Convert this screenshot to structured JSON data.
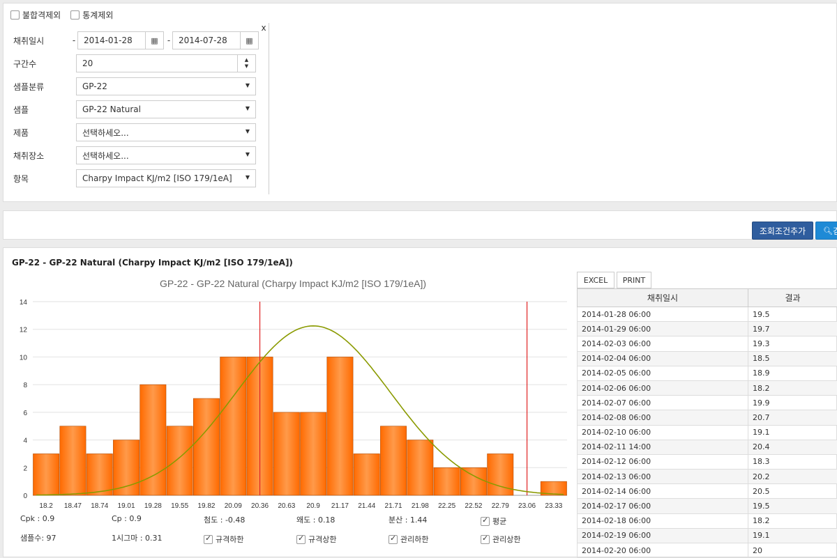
{
  "filters": {
    "exclude_nonconforming": "불합격제외",
    "exclude_stats": "통계제외",
    "close": "x",
    "date_label": "채취일시",
    "date_from": "2014-01-28",
    "date_to": "2014-07-28",
    "bins_label": "구간수",
    "bins_value": "20",
    "sample_class_label": "샘플분류",
    "sample_class_value": "GP-22",
    "sample_label": "샘플",
    "sample_value": "GP-22 Natural",
    "product_label": "제품",
    "product_value": "선택하세오...",
    "location_label": "채취장소",
    "location_value": "선택하세오...",
    "item_label": "항목",
    "item_value": "Charpy Impact KJ/m2 [ISO 179/1eA]"
  },
  "actions": {
    "add_condition": "조회조건추가",
    "search": "검"
  },
  "section_title": "GP-22 - GP-22 Natural (Charpy Impact KJ/m2 [ISO 179/1eA])",
  "chart_data": {
    "type": "bar",
    "title": "GP-22 - GP-22 Natural (Charpy Impact KJ/m2 [ISO 179/1eA])",
    "categories": [
      "18.2",
      "18.47",
      "18.74",
      "19.01",
      "19.28",
      "19.55",
      "19.82",
      "20.09",
      "20.36",
      "20.63",
      "20.9",
      "21.17",
      "21.44",
      "21.71",
      "21.98",
      "22.25",
      "22.52",
      "22.79",
      "23.06",
      "23.33"
    ],
    "values": [
      3,
      5,
      3,
      4,
      8,
      5,
      7,
      10,
      10,
      6,
      6,
      10,
      3,
      5,
      4,
      2,
      2,
      3,
      0,
      1
    ],
    "normal_curve": {
      "mean": 20.9,
      "peak": 12.25
    },
    "spec_lines": [
      20.36,
      23.06
    ],
    "ylim": [
      0,
      14
    ],
    "yticks": [
      0,
      2,
      4,
      6,
      8,
      10,
      12,
      14
    ],
    "bar_color": "#ff7a1a",
    "curve_color": "#8a9a00",
    "line_color": "#e02020"
  },
  "stats": {
    "cpk": "Cpk : 0.9",
    "cp": "Cp : 0.9",
    "kurtosis": "첨도 : -0.48",
    "skewness": "왜도 : 0.18",
    "variance": "분산 : 1.44",
    "mean_label": "평균",
    "samples": "샘플수: 97",
    "sigma": "1시그마 : 0.31",
    "lsl": "규격하한",
    "usl": "규격상한",
    "lcl": "관리하한",
    "ucl": "관리상한"
  },
  "table": {
    "excel": "EXCEL",
    "print": "PRINT",
    "col_date": "채취일시",
    "col_result": "결과",
    "rows": [
      [
        "2014-01-28 06:00",
        "19.5"
      ],
      [
        "2014-01-29 06:00",
        "19.7"
      ],
      [
        "2014-02-03 06:00",
        "19.3"
      ],
      [
        "2014-02-04 06:00",
        "18.5"
      ],
      [
        "2014-02-05 06:00",
        "18.9"
      ],
      [
        "2014-02-06 06:00",
        "18.2"
      ],
      [
        "2014-02-07 06:00",
        "19.9"
      ],
      [
        "2014-02-08 06:00",
        "20.7"
      ],
      [
        "2014-02-10 06:00",
        "19.1"
      ],
      [
        "2014-02-11 14:00",
        "20.4"
      ],
      [
        "2014-02-12 06:00",
        "18.3"
      ],
      [
        "2014-02-13 06:00",
        "20.2"
      ],
      [
        "2014-02-14 06:00",
        "20.5"
      ],
      [
        "2014-02-17 06:00",
        "19.5"
      ],
      [
        "2014-02-18 06:00",
        "18.2"
      ],
      [
        "2014-02-19 06:00",
        "19.1"
      ],
      [
        "2014-02-20 06:00",
        "20"
      ]
    ]
  }
}
